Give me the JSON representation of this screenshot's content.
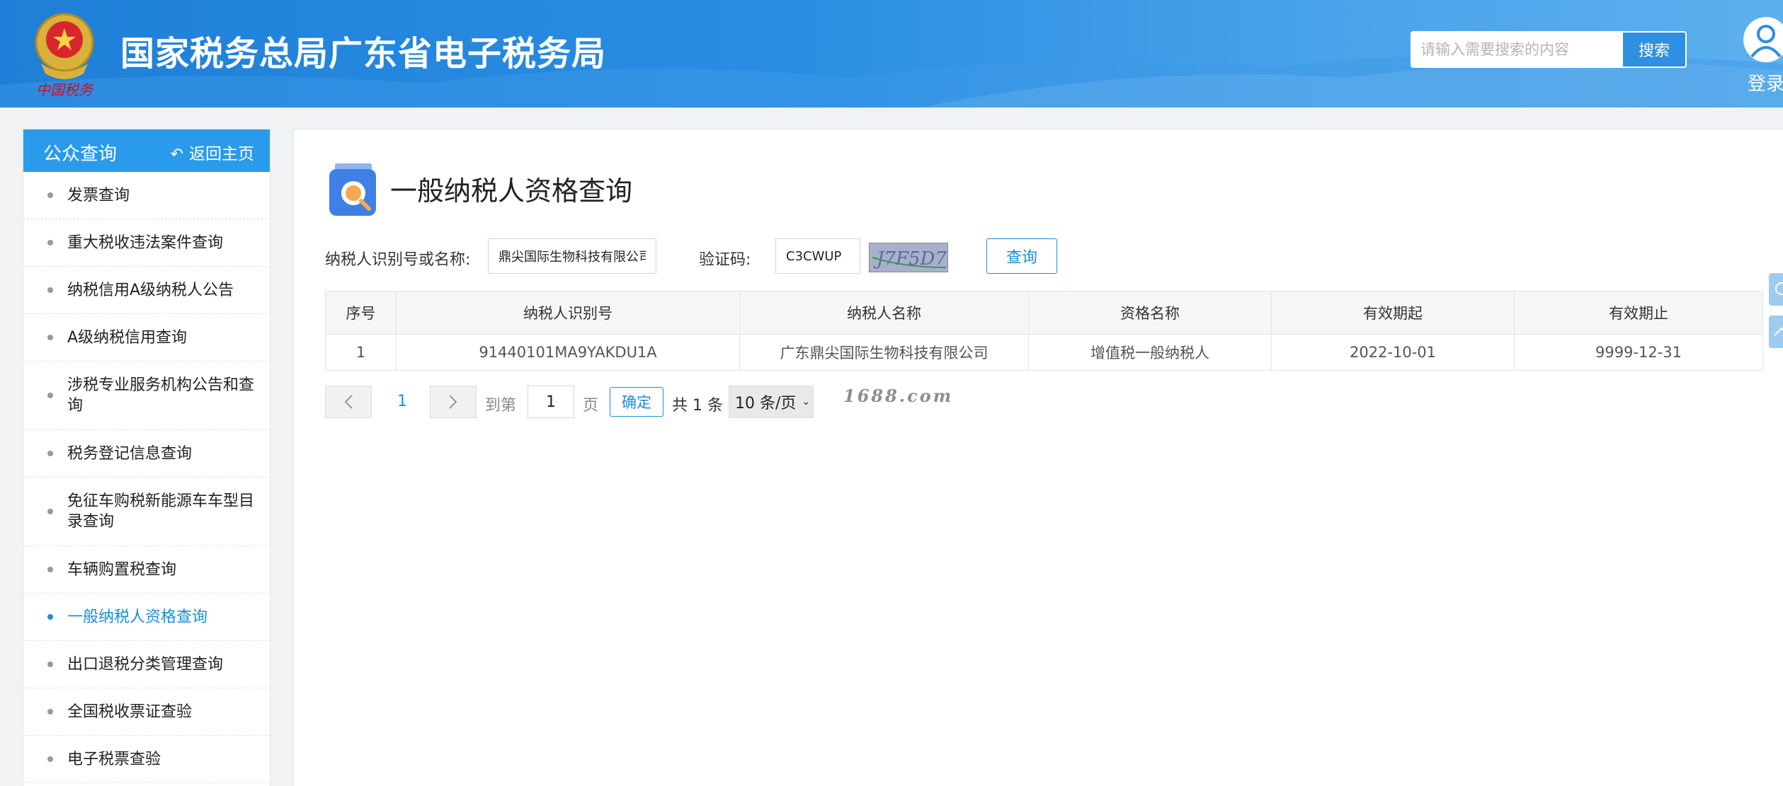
{
  "header": {
    "site_title": "国家税务总局广东省电子税务局",
    "emblem_text": "中国税务",
    "search_placeholder": "请输入需要搜索的内容",
    "search_label": "搜索",
    "login_label": "登录"
  },
  "sidebar": {
    "title": "公众查询",
    "back_label": "返回主页",
    "items": [
      {
        "label": "发票查询",
        "active": false
      },
      {
        "label": "重大税收违法案件查询",
        "active": false
      },
      {
        "label": "纳税信用A级纳税人公告",
        "active": false
      },
      {
        "label": "A级纳税信用查询",
        "active": false
      },
      {
        "label": "涉税专业服务机构公告和查询",
        "active": false
      },
      {
        "label": "税务登记信息查询",
        "active": false
      },
      {
        "label": "免征车购税新能源车车型目录查询",
        "active": false
      },
      {
        "label": "车辆购置税查询",
        "active": false
      },
      {
        "label": "一般纳税人资格查询",
        "active": true
      },
      {
        "label": "出口退税分类管理查询",
        "active": false
      },
      {
        "label": "全国税收票证查验",
        "active": false
      },
      {
        "label": "电子税票查验",
        "active": false
      }
    ]
  },
  "main": {
    "page_title": "一般纳税人资格查询",
    "form": {
      "taxpayer_label": "纳税人识别号或名称:",
      "taxpayer_value": "鼎尖国际生物科技有限公司",
      "captcha_label": "验证码:",
      "captcha_value": "C3CWUP",
      "captcha_image_text": "J7F5D7",
      "query_label": "查询"
    },
    "table": {
      "headers": [
        "序号",
        "纳税人识别号",
        "纳税人名称",
        "资格名称",
        "有效期起",
        "有效期止"
      ],
      "rows": [
        [
          "1",
          "91440101MA9YAKDU1A",
          "广东鼎尖国际生物科技有限公司",
          "增值税一般纳税人",
          "2022-10-01",
          "9999-12-31"
        ]
      ]
    },
    "pagination": {
      "prev_icon": "chevron-left-icon",
      "next_icon": "chevron-right-icon",
      "current_page": "1",
      "goto_label": "到第",
      "goto_value": "1",
      "page_suffix": "页",
      "confirm_label": "确定",
      "total_label": "共 1 条",
      "page_size": "10 条/页"
    },
    "watermark": "1688.com"
  },
  "colors": {
    "header_blue": "#2a8ee2",
    "accent": "#1a8fd6",
    "sidebar_head": "#2a9bea"
  }
}
